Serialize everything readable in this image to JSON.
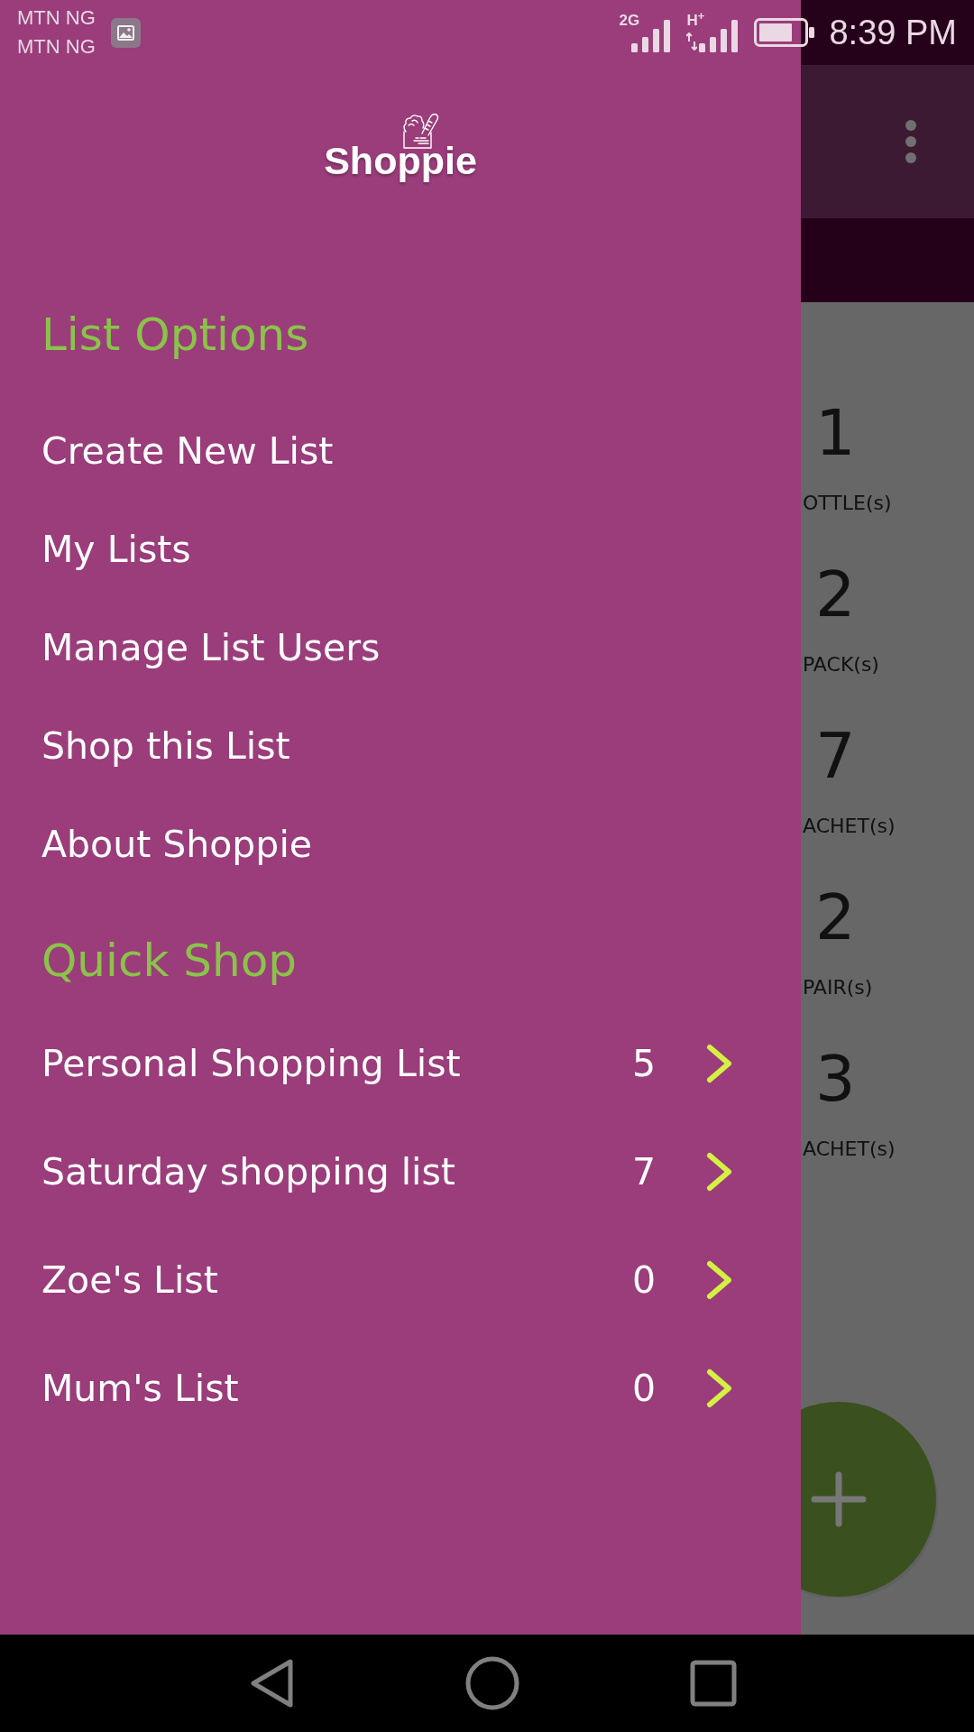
{
  "status_bar": {
    "carriers": [
      "MTN NG",
      "MTN NG"
    ],
    "networks": [
      {
        "type": "2G",
        "data_activity": false
      },
      {
        "type": "H$^{+}$",
        "data_activity": true
      }
    ],
    "time": "8:39 PM"
  },
  "drawer": {
    "logo": "Shoppie",
    "sections": [
      {
        "kind": "menu",
        "heading": "List Options",
        "items": [
          {
            "label": "Create New List"
          },
          {
            "label": "My Lists"
          },
          {
            "label": "Manage List Users"
          },
          {
            "label": "Shop this List"
          },
          {
            "label": "About Shoppie"
          }
        ]
      },
      {
        "kind": "lists",
        "heading": "Quick Shop",
        "items": [
          {
            "name": "Personal Shopping List",
            "count": "5"
          },
          {
            "name": "Saturday shopping list",
            "count": "7"
          },
          {
            "name": "Zoe's List",
            "count": "0"
          },
          {
            "name": "Mum's List",
            "count": "0"
          }
        ]
      }
    ]
  },
  "background_list": {
    "items": [
      {
        "quantity": "1",
        "unit": "OTTLE(s)"
      },
      {
        "quantity": "2",
        "unit": "PACK(s)"
      },
      {
        "quantity": "7",
        "unit": "ACHET(s)"
      },
      {
        "quantity": "2",
        "unit": "PAIR(s)"
      },
      {
        "quantity": "3",
        "unit": "ACHET(s)"
      }
    ]
  }
}
